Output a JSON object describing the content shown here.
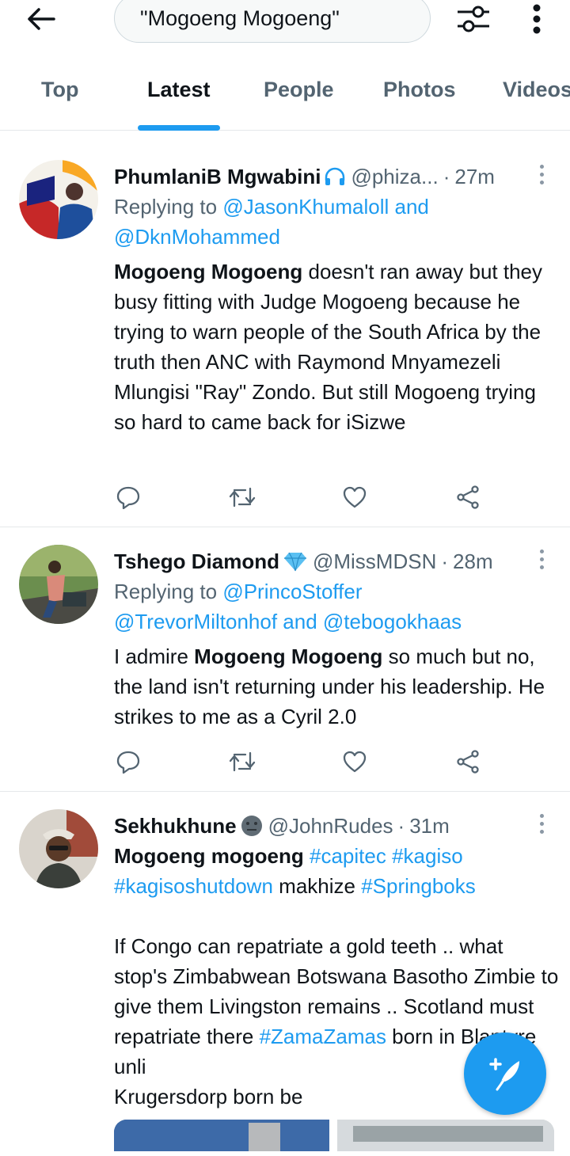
{
  "search": {
    "query": "\"Mogoeng Mogoeng\""
  },
  "tabs": [
    "Top",
    "Latest",
    "People",
    "Photos",
    "Videos"
  ],
  "active_tab": "Latest",
  "tweets": [
    {
      "name": "PhumlaniB Mgwabini",
      "name_emoji": "headphones",
      "handle": "@phiza...",
      "time": "27m",
      "replying_prefix": "Replying to",
      "replying_line1": "@JasonKhumaloll and",
      "replying_line2": "@DknMohammed",
      "text_bold": "Mogoeng Mogoeng",
      "text": " doesn't ran away but they busy fitting with Judge Mogoeng because he trying to warn people of the South Africa by the truth then ANC with Raymond Mnyamezeli Mlungisi \"Ray\" Zondo. But still Mogoeng trying so hard to came back for iSizwe"
    },
    {
      "name": "Tshego Diamond",
      "name_emoji": "gem",
      "handle": "@MissMDSN",
      "time": "28m",
      "replying_prefix": "Replying to",
      "replying_line1": "@PrincoStoffer",
      "replying_line2": "@TrevorMiltonhof and @tebogokhaas",
      "text_pre": "I admire ",
      "text_bold": "Mogoeng Mogoeng",
      "text": " so much but no, the land isn't returning under his leadership. He strikes to me as a Cyril 2.0"
    },
    {
      "name": "Sekhukhune",
      "name_emoji": "neutral-face",
      "handle": "@JohnRudes",
      "time": "31m",
      "text_bold": "Mogoeng mogoeng",
      "hashtag1": "#capitec",
      "hashtag2": "#kagiso",
      "hashtag3": "#kagisoshutdown",
      "word1": "makhize",
      "hashtag4": "#Springboks",
      "para2": "If Congo can repatriate a gold teeth .. what stop's Zimbabwean Botswana Basotho Zimbie to give them Livingston remains .. Scotland must repatriate there",
      "hashtag5": "#ZamaZamas",
      "para2_end": " born in Blantyre  unli",
      "para2_last": "Krugersdorp born be"
    }
  ],
  "colors": {
    "accent": "#1d9bf0",
    "muted": "#536471",
    "text": "#0f1419",
    "divider": "#e5e8ea"
  }
}
